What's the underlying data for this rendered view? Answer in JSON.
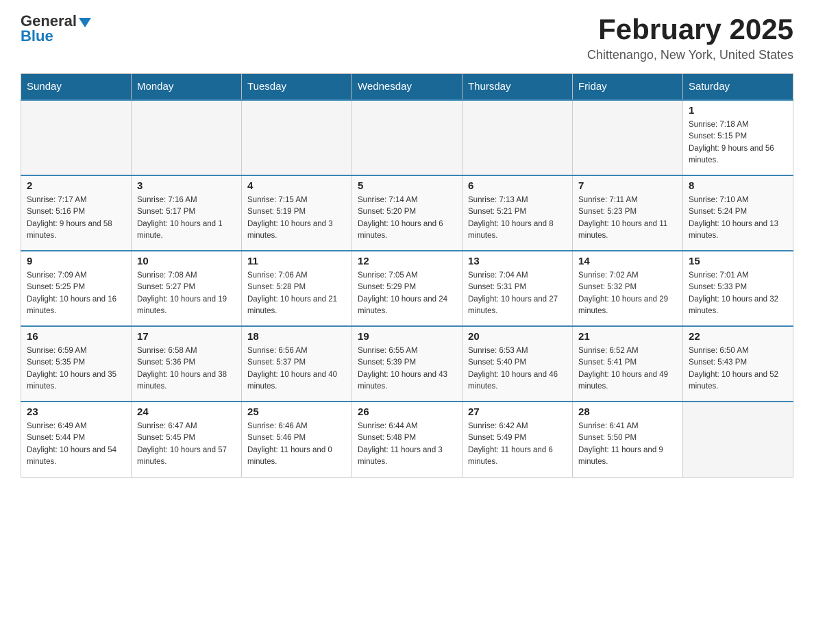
{
  "header": {
    "logo_general": "General",
    "logo_blue": "Blue",
    "month_title": "February 2025",
    "location": "Chittenango, New York, United States"
  },
  "days_of_week": [
    "Sunday",
    "Monday",
    "Tuesday",
    "Wednesday",
    "Thursday",
    "Friday",
    "Saturday"
  ],
  "weeks": [
    [
      {
        "day": "",
        "sunrise": "",
        "sunset": "",
        "daylight": ""
      },
      {
        "day": "",
        "sunrise": "",
        "sunset": "",
        "daylight": ""
      },
      {
        "day": "",
        "sunrise": "",
        "sunset": "",
        "daylight": ""
      },
      {
        "day": "",
        "sunrise": "",
        "sunset": "",
        "daylight": ""
      },
      {
        "day": "",
        "sunrise": "",
        "sunset": "",
        "daylight": ""
      },
      {
        "day": "",
        "sunrise": "",
        "sunset": "",
        "daylight": ""
      },
      {
        "day": "1",
        "sunrise": "Sunrise: 7:18 AM",
        "sunset": "Sunset: 5:15 PM",
        "daylight": "Daylight: 9 hours and 56 minutes."
      }
    ],
    [
      {
        "day": "2",
        "sunrise": "Sunrise: 7:17 AM",
        "sunset": "Sunset: 5:16 PM",
        "daylight": "Daylight: 9 hours and 58 minutes."
      },
      {
        "day": "3",
        "sunrise": "Sunrise: 7:16 AM",
        "sunset": "Sunset: 5:17 PM",
        "daylight": "Daylight: 10 hours and 1 minute."
      },
      {
        "day": "4",
        "sunrise": "Sunrise: 7:15 AM",
        "sunset": "Sunset: 5:19 PM",
        "daylight": "Daylight: 10 hours and 3 minutes."
      },
      {
        "day": "5",
        "sunrise": "Sunrise: 7:14 AM",
        "sunset": "Sunset: 5:20 PM",
        "daylight": "Daylight: 10 hours and 6 minutes."
      },
      {
        "day": "6",
        "sunrise": "Sunrise: 7:13 AM",
        "sunset": "Sunset: 5:21 PM",
        "daylight": "Daylight: 10 hours and 8 minutes."
      },
      {
        "day": "7",
        "sunrise": "Sunrise: 7:11 AM",
        "sunset": "Sunset: 5:23 PM",
        "daylight": "Daylight: 10 hours and 11 minutes."
      },
      {
        "day": "8",
        "sunrise": "Sunrise: 7:10 AM",
        "sunset": "Sunset: 5:24 PM",
        "daylight": "Daylight: 10 hours and 13 minutes."
      }
    ],
    [
      {
        "day": "9",
        "sunrise": "Sunrise: 7:09 AM",
        "sunset": "Sunset: 5:25 PM",
        "daylight": "Daylight: 10 hours and 16 minutes."
      },
      {
        "day": "10",
        "sunrise": "Sunrise: 7:08 AM",
        "sunset": "Sunset: 5:27 PM",
        "daylight": "Daylight: 10 hours and 19 minutes."
      },
      {
        "day": "11",
        "sunrise": "Sunrise: 7:06 AM",
        "sunset": "Sunset: 5:28 PM",
        "daylight": "Daylight: 10 hours and 21 minutes."
      },
      {
        "day": "12",
        "sunrise": "Sunrise: 7:05 AM",
        "sunset": "Sunset: 5:29 PM",
        "daylight": "Daylight: 10 hours and 24 minutes."
      },
      {
        "day": "13",
        "sunrise": "Sunrise: 7:04 AM",
        "sunset": "Sunset: 5:31 PM",
        "daylight": "Daylight: 10 hours and 27 minutes."
      },
      {
        "day": "14",
        "sunrise": "Sunrise: 7:02 AM",
        "sunset": "Sunset: 5:32 PM",
        "daylight": "Daylight: 10 hours and 29 minutes."
      },
      {
        "day": "15",
        "sunrise": "Sunrise: 7:01 AM",
        "sunset": "Sunset: 5:33 PM",
        "daylight": "Daylight: 10 hours and 32 minutes."
      }
    ],
    [
      {
        "day": "16",
        "sunrise": "Sunrise: 6:59 AM",
        "sunset": "Sunset: 5:35 PM",
        "daylight": "Daylight: 10 hours and 35 minutes."
      },
      {
        "day": "17",
        "sunrise": "Sunrise: 6:58 AM",
        "sunset": "Sunset: 5:36 PM",
        "daylight": "Daylight: 10 hours and 38 minutes."
      },
      {
        "day": "18",
        "sunrise": "Sunrise: 6:56 AM",
        "sunset": "Sunset: 5:37 PM",
        "daylight": "Daylight: 10 hours and 40 minutes."
      },
      {
        "day": "19",
        "sunrise": "Sunrise: 6:55 AM",
        "sunset": "Sunset: 5:39 PM",
        "daylight": "Daylight: 10 hours and 43 minutes."
      },
      {
        "day": "20",
        "sunrise": "Sunrise: 6:53 AM",
        "sunset": "Sunset: 5:40 PM",
        "daylight": "Daylight: 10 hours and 46 minutes."
      },
      {
        "day": "21",
        "sunrise": "Sunrise: 6:52 AM",
        "sunset": "Sunset: 5:41 PM",
        "daylight": "Daylight: 10 hours and 49 minutes."
      },
      {
        "day": "22",
        "sunrise": "Sunrise: 6:50 AM",
        "sunset": "Sunset: 5:43 PM",
        "daylight": "Daylight: 10 hours and 52 minutes."
      }
    ],
    [
      {
        "day": "23",
        "sunrise": "Sunrise: 6:49 AM",
        "sunset": "Sunset: 5:44 PM",
        "daylight": "Daylight: 10 hours and 54 minutes."
      },
      {
        "day": "24",
        "sunrise": "Sunrise: 6:47 AM",
        "sunset": "Sunset: 5:45 PM",
        "daylight": "Daylight: 10 hours and 57 minutes."
      },
      {
        "day": "25",
        "sunrise": "Sunrise: 6:46 AM",
        "sunset": "Sunset: 5:46 PM",
        "daylight": "Daylight: 11 hours and 0 minutes."
      },
      {
        "day": "26",
        "sunrise": "Sunrise: 6:44 AM",
        "sunset": "Sunset: 5:48 PM",
        "daylight": "Daylight: 11 hours and 3 minutes."
      },
      {
        "day": "27",
        "sunrise": "Sunrise: 6:42 AM",
        "sunset": "Sunset: 5:49 PM",
        "daylight": "Daylight: 11 hours and 6 minutes."
      },
      {
        "day": "28",
        "sunrise": "Sunrise: 6:41 AM",
        "sunset": "Sunset: 5:50 PM",
        "daylight": "Daylight: 11 hours and 9 minutes."
      },
      {
        "day": "",
        "sunrise": "",
        "sunset": "",
        "daylight": ""
      }
    ]
  ]
}
